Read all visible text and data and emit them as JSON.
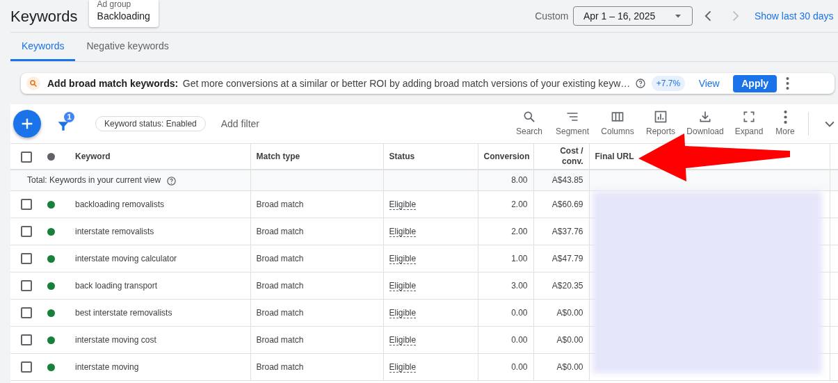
{
  "header": {
    "title": "Keywords",
    "ad_group": {
      "label": "Ad group",
      "value": "Backloading"
    },
    "date_label": "Custom",
    "date_range": "Apr 1 – 16, 2025",
    "show_last": "Show last 30 days"
  },
  "tabs": [
    {
      "label": "Keywords",
      "selected": true
    },
    {
      "label": "Negative keywords",
      "selected": false
    }
  ],
  "recommendation": {
    "title": "Add broad match keywords:",
    "text": "Get more conversions at a similar or better ROI by adding broad match versions of your existing keyw…",
    "uplift": "+7.7%",
    "view": "View",
    "apply": "Apply"
  },
  "toolbar": {
    "filter_count": "1",
    "filter_chip": "Keyword status: Enabled",
    "add_filter": "Add filter",
    "actions": [
      {
        "kind": "search",
        "label": "Search"
      },
      {
        "kind": "segment",
        "label": "Segment"
      },
      {
        "kind": "columns",
        "label": "Columns"
      },
      {
        "kind": "reports",
        "label": "Reports"
      },
      {
        "kind": "download",
        "label": "Download"
      },
      {
        "kind": "expand",
        "label": "Expand"
      },
      {
        "kind": "more",
        "label": "More"
      }
    ]
  },
  "table": {
    "select_all_checked": false,
    "columns": [
      "Keyword",
      "Match type",
      "Status",
      "Conversion",
      "Cost / conv.",
      "Final URL"
    ],
    "total": {
      "label": "Total: Keywords in your current view",
      "conversions": "8.00",
      "cost": "A$43.85"
    },
    "rows": [
      {
        "checked": false,
        "color": "#188038",
        "keyword": "backloading removalists",
        "match": "Broad match",
        "status": "Eligible",
        "conversions": "2.00",
        "cost": "A$60.69"
      },
      {
        "checked": false,
        "color": "#188038",
        "keyword": "interstate removalists",
        "match": "Broad match",
        "status": "Eligible",
        "conversions": "2.00",
        "cost": "A$37.76"
      },
      {
        "checked": false,
        "color": "#188038",
        "keyword": "interstate moving calculator",
        "match": "Broad match",
        "status": "Eligible",
        "conversions": "1.00",
        "cost": "A$47.79"
      },
      {
        "checked": false,
        "color": "#188038",
        "keyword": "back loading transport",
        "match": "Broad match",
        "status": "Eligible",
        "conversions": "3.00",
        "cost": "A$20.35"
      },
      {
        "checked": false,
        "color": "#188038",
        "keyword": "best interstate removalists",
        "match": "Broad match",
        "status": "Eligible",
        "conversions": "0.00",
        "cost": "A$0.00"
      },
      {
        "checked": false,
        "color": "#188038",
        "keyword": "interstate moving cost",
        "match": "Broad match",
        "status": "Eligible",
        "conversions": "0.00",
        "cost": "A$0.00"
      },
      {
        "checked": false,
        "color": "#188038",
        "keyword": "interstate moving",
        "match": "Broad match",
        "status": "Eligible",
        "conversions": "0.00",
        "cost": "A$0.00"
      }
    ]
  }
}
